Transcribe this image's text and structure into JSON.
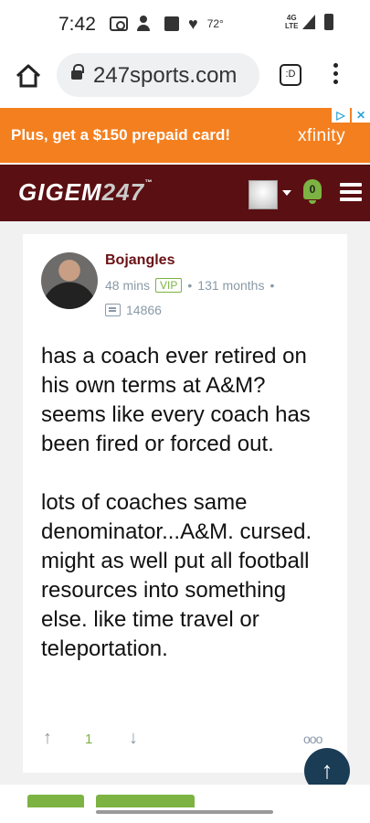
{
  "status_bar": {
    "time": "7:42",
    "temperature": "72°",
    "network": "4G LTE",
    "icons": [
      "cast-icon",
      "add-person-icon",
      "photo-icon",
      "heart-icon",
      "signal-icon",
      "battery-icon"
    ]
  },
  "browser": {
    "url": "247sports.com",
    "tabs_label": ":D"
  },
  "ad": {
    "text": "Plus, get a $150 prepaid card!",
    "brand": "xfinity",
    "choices_icon": "▷",
    "close_icon": "✕"
  },
  "site": {
    "logo_text": "GIGEM",
    "logo_number": "247",
    "logo_tm": "™",
    "notification_count": "0"
  },
  "post": {
    "author": "Bojangles",
    "time_ago": "48 mins",
    "badge": "VIP",
    "tenure": "131 months",
    "post_count": "14866",
    "body_paragraphs": [
      "has a coach ever retired on his own terms at A&M? seems like every coach has been fired or forced out.",
      "lots of coaches same denominator...A&M. cursed. might as well put all football resources into something else. like time travel or teleportation."
    ],
    "vote_count": "1"
  },
  "colors": {
    "ad_orange": "#f47f1f",
    "header_maroon": "#5a0f12",
    "accent_green": "#7cb342",
    "author_maroon": "#6b1216",
    "scroll_button": "#1a3c55"
  }
}
